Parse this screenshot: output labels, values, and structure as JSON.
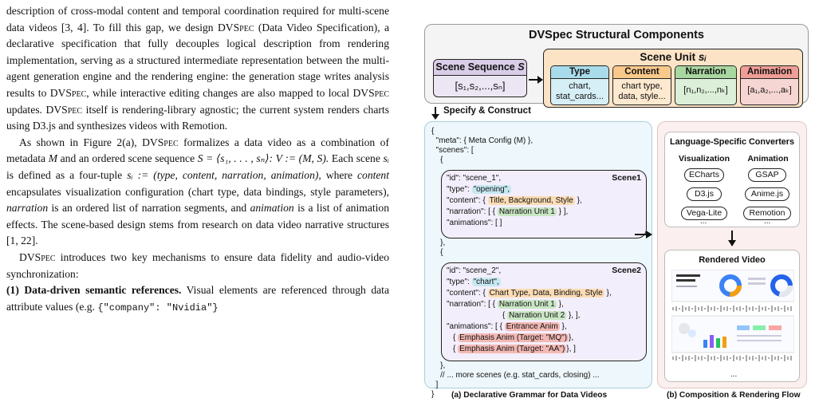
{
  "text": {
    "p1_a": "description of cross-modal content and temporal coordination required for multi-scene data videos [3, 4]. To fill this gap, we design ",
    "dvspec": "DVSpec",
    "p1_b": " (Data Video Specification), a declarative specification that fully decouples logical description from rendering implementation, serving as a structured intermediate representation between the multi-agent generation engine and the rendering engine: the generation stage writes analysis results to ",
    "p1_c": ", while interactive editing changes are also mapped to local ",
    "p1_d": " updates. ",
    "p1_e": " itself is rendering-library agnostic; the current system renders charts using D3.js and synthesizes videos with Remotion.",
    "p2_a": "As shown in Figure 2(a), ",
    "p2_b": " formalizes a data video as a combination of metadata ",
    "M": "M",
    "p2_c": " and an ordered scene sequence ",
    "seq_def": "S = ⟨s₁, . . . , sₙ⟩: V := (M, S).",
    "p2_d": " Each scene ",
    "si": "sᵢ",
    "p2_e": " is defined as a four-tuple ",
    "tuple": "sᵢ := (type, content, narration, animation),",
    "p2_f": " where ",
    "content": "content",
    "p2_g": " encapsulates visualization configuration (chart type, data bindings, style parameters), ",
    "narration": "narration",
    "p2_h": " is an ordered list of narration segments, and ",
    "animation": "animation",
    "p2_i": " is a list of animation effects. The scene-based design stems from research on data video narrative structures [1, 22].",
    "p3_b": " introduces two key mechanisms to ensure data fidelity and audio-video synchronization:",
    "p4_bold": "(1) Data-driven semantic references.",
    "p4_a": " Visual elements are referenced through data attribute values (e.g. ",
    "p4_code": "{\"company\": \"Nvidia\"}"
  },
  "figure": {
    "top_title": "DVSpec Structural Components",
    "scene_sequence": {
      "label": "Scene Sequence",
      "var": "S",
      "value": "[s₁,s₂,...,sₙ]"
    },
    "scene_unit": {
      "label": "Scene Unit",
      "var": "sᵢ",
      "cards": [
        {
          "title": "Type",
          "line1": "chart,",
          "line2": "stat_cards...",
          "bg": "#d6eff6",
          "hdr": "#a9dcea"
        },
        {
          "title": "Content",
          "line1": "chart type,",
          "line2": "data, style...",
          "bg": "#fde9cf",
          "hdr": "#f8c98a"
        },
        {
          "title": "Narration",
          "line1": "[n₁,n₂,...,nₖ]",
          "line2": "",
          "bg": "#dcefd8",
          "hdr": "#a9d7a0"
        },
        {
          "title": "Animation",
          "line1": "[a₁,a₂,...,aₖ]",
          "line2": "",
          "bg": "#f6d6d3",
          "hdr": "#ee9d97"
        }
      ]
    },
    "specify_label": "Specify & Construct",
    "code": {
      "l0": "{",
      "l1": "  \"meta\": { Meta Config (M) },",
      "l2": "  \"scenes\": [",
      "l3": "    {",
      "s1_id": "\"id\": \"scene_1\",",
      "s1_type_key": "\"type\": ",
      "s1_type_val": "\"opening\",",
      "s1_content_key": "\"content\": {",
      "s1_content_val": "Title, Background, Style",
      "s1_content_end": "},",
      "s1_narr_key": "\"narration\": [ {",
      "s1_narr_val": "Narration Unit 1",
      "s1_narr_end": "} ],",
      "s1_anim": "\"animations\": [ ]",
      "scene1_label": "Scene1",
      "mid1": "    },",
      "mid2": "    {",
      "s2_id": "\"id\": \"scene_2\",",
      "s2_type_key": "\"type\": ",
      "s2_type_val": "\"chart\",",
      "s2_content_key": "\"content\": {",
      "s2_content_val": "Chart Type, Data, Binding, Style",
      "s2_content_end": "},",
      "s2_narr_key": "\"narration\": [ {",
      "s2_narr_val1": "Narration Unit 1",
      "s2_narr_end1": "},",
      "s2_narr_val2": "Narration Unit 2",
      "s2_narr_end2": "},  ],",
      "s2_anim_key": "\"animations\": [ {",
      "s2_anim_val1": "Entrance Anim",
      "s2_anim_end1": "},",
      "s2_anim_val2": "Emphasis Anim (Target: \"MQ\")",
      "s2_anim_end2": "},",
      "s2_anim_val3": "Emphasis Anim (Target: \"AA\")",
      "s2_anim_end3": "}, ]",
      "scene2_label": "Scene2",
      "t1": "    },",
      "t2": "    // ... more scenes (e.g. stat_cards, closing) ...",
      "t3": "  ]",
      "t4": "}"
    },
    "converters": {
      "title": "Language-Specific Converters",
      "vis_header": "Visualization",
      "anim_header": "Animation",
      "vis": [
        "ECharts",
        "D3.js",
        "Vega-Lite"
      ],
      "anim": [
        "GSAP",
        "Anime.js",
        "Remotion"
      ],
      "ellipsis": "..."
    },
    "rendered": {
      "title": "Rendered Video",
      "ellipsis": "..."
    },
    "caption_a": "(a) Declarative Grammar for Data Videos",
    "caption_b": "(b) Composition & Rendering Flow"
  }
}
